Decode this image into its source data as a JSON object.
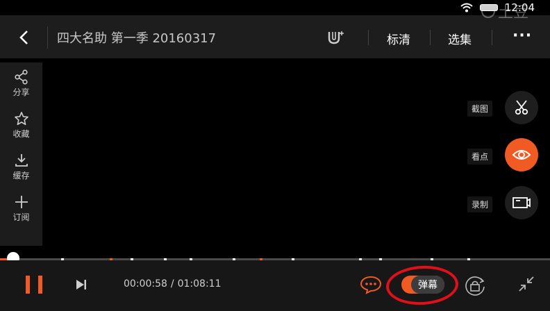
{
  "status_bar": {
    "time": "12:04"
  },
  "header": {
    "title": "四大名助 第一季 20160317",
    "quality_label": "标清",
    "episodes_label": "选集",
    "more_label": "···",
    "watermark_text": "土豆"
  },
  "sidebar": {
    "items": [
      {
        "icon": "share-icon",
        "label": "分享"
      },
      {
        "icon": "star-icon",
        "label": "收藏"
      },
      {
        "icon": "download-icon",
        "label": "缓存"
      },
      {
        "icon": "plus-icon",
        "label": "订阅"
      }
    ]
  },
  "floating_actions": [
    {
      "icon": "scissors-icon",
      "label": "截图",
      "active": false
    },
    {
      "icon": "eye-icon",
      "label": "看点",
      "active": true
    },
    {
      "icon": "record-icon",
      "label": "录制",
      "active": false
    }
  ],
  "player": {
    "current_time": "00:00:58",
    "separator": "/",
    "total_time": "01:08:11",
    "progress": 0.014,
    "danmu_label": "弹幕",
    "danmu_enabled": true
  },
  "colors": {
    "accent": "#f15a22",
    "annotation": "#e0101a",
    "bar_bg": "#1d1d1d"
  }
}
